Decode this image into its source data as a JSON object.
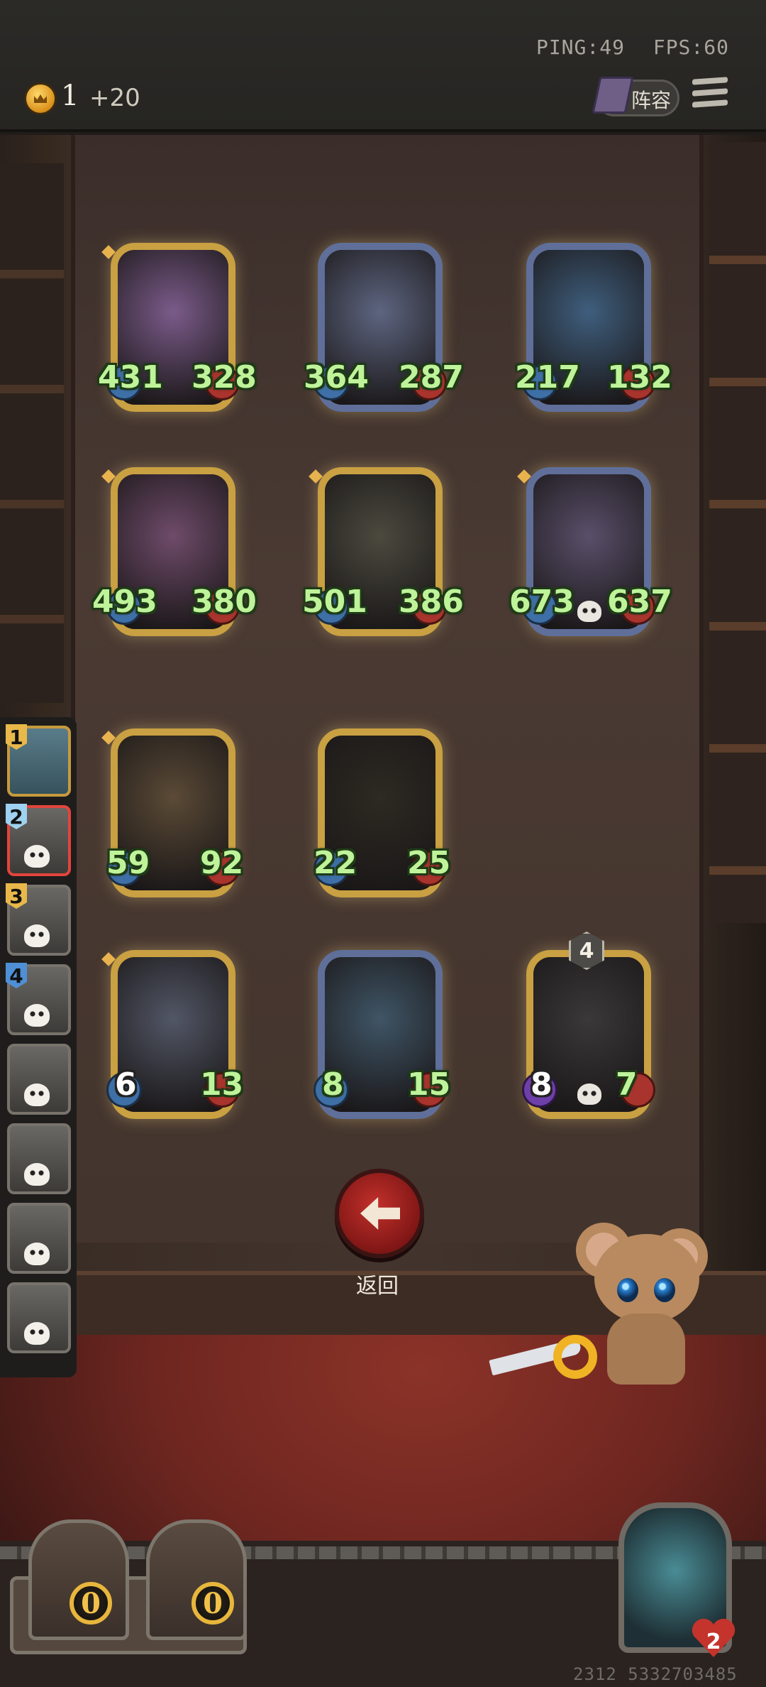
{
  "hud": {
    "ping": "PING:49",
    "fps": "FPS:60",
    "gold": "1",
    "gold_income": "+20",
    "lineup_label": "阵容"
  },
  "board": {
    "cards": [
      {
        "atk": "431",
        "hp": "328",
        "frame": "gold",
        "art": "#7b5b8a"
      },
      {
        "atk": "364",
        "hp": "287",
        "frame": "blue",
        "art": "#5d6580"
      },
      {
        "atk": "217",
        "hp": "132",
        "frame": "blue",
        "art": "#3f5e7d"
      },
      {
        "atk": "493",
        "hp": "380",
        "frame": "gold",
        "art": "#6f4b6a"
      },
      {
        "atk": "501",
        "hp": "386",
        "frame": "gold",
        "art": "#4b4a3e"
      },
      {
        "atk": "673",
        "hp": "637",
        "frame": "blue",
        "art": "#5a4f6a"
      },
      {
        "atk": "59",
        "hp": "92",
        "frame": "gold",
        "art": "#5b4a36"
      },
      {
        "atk": "22",
        "hp": "25",
        "frame": "gold",
        "art": "#2d2a22"
      },
      {
        "atk": "6",
        "hp": "13",
        "frame": "gold",
        "art": "#525766"
      },
      {
        "atk": "8",
        "hp": "15",
        "frame": "blue",
        "art": "#3f5566"
      },
      {
        "atk": "8",
        "hp": "7",
        "frame": "gold",
        "art": "#3a3838",
        "tier": "4"
      }
    ]
  },
  "roster": {
    "slots": [
      {
        "num": "1",
        "color": "#e8b84a"
      },
      {
        "num": "2",
        "color": "#9fd1f0"
      },
      {
        "num": "3",
        "color": "#e8b84a"
      },
      {
        "num": "4",
        "color": "#4f8fd6"
      }
    ]
  },
  "back_label": "返回",
  "bottom": {
    "chest_left": "0",
    "chest_right": "0",
    "health": "2",
    "footer_id": "2312 5332703485"
  }
}
